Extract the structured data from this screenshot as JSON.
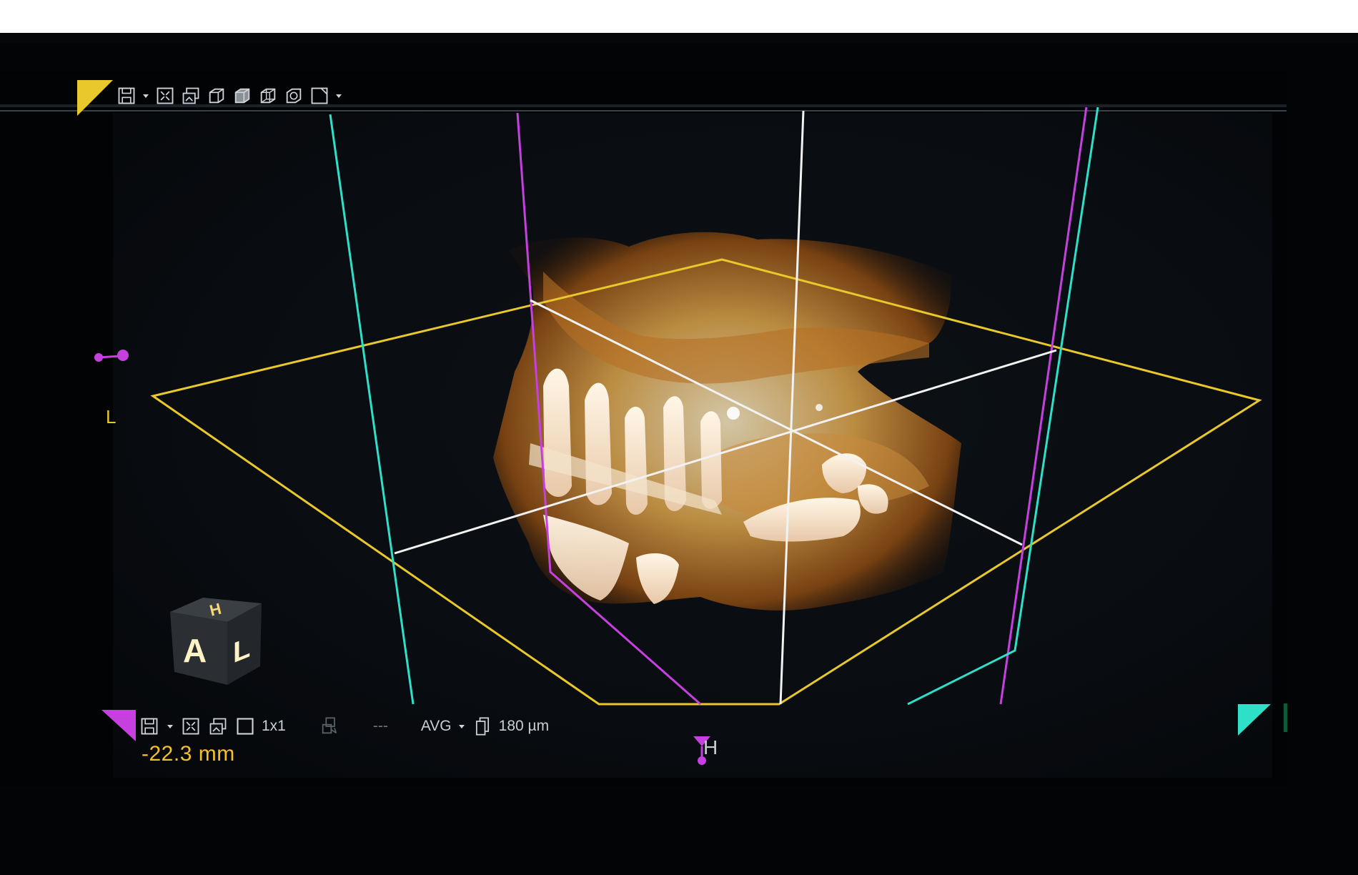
{
  "viewer": {
    "orientation_left_label": "L",
    "slice_position": "-22.3 mm",
    "cursor_label": "H",
    "layout": "1x1",
    "dash_value": "---",
    "projection_mode": "AVG",
    "slice_thickness": "180 µm"
  },
  "orientation_cube": {
    "top_face": "H",
    "front_face": "A",
    "side_face": "L"
  },
  "colors": {
    "axial_plane": "#e8c82a",
    "sagittal_plane": "#c640e0",
    "coronal_plane": "#2fe0c8",
    "crosshair": "#f2f2f2",
    "measurement_text": "#f3c02c"
  },
  "icons": {
    "top_toolbar": [
      "save-icon",
      "dropdown-caret-icon",
      "fit-view-icon",
      "export-image-icon",
      "cube-view-icon",
      "cube-solid-icon",
      "cube-wire-icon",
      "cube-axes-icon",
      "view-preset-icon",
      "dropdown-caret-icon"
    ],
    "bottom_toolbar": [
      "save-icon",
      "dropdown-caret-icon",
      "fit-view-icon",
      "export-image-icon",
      "single-layout-icon",
      "link-views-icon",
      "dropdown-caret-icon",
      "stack-icon"
    ]
  }
}
